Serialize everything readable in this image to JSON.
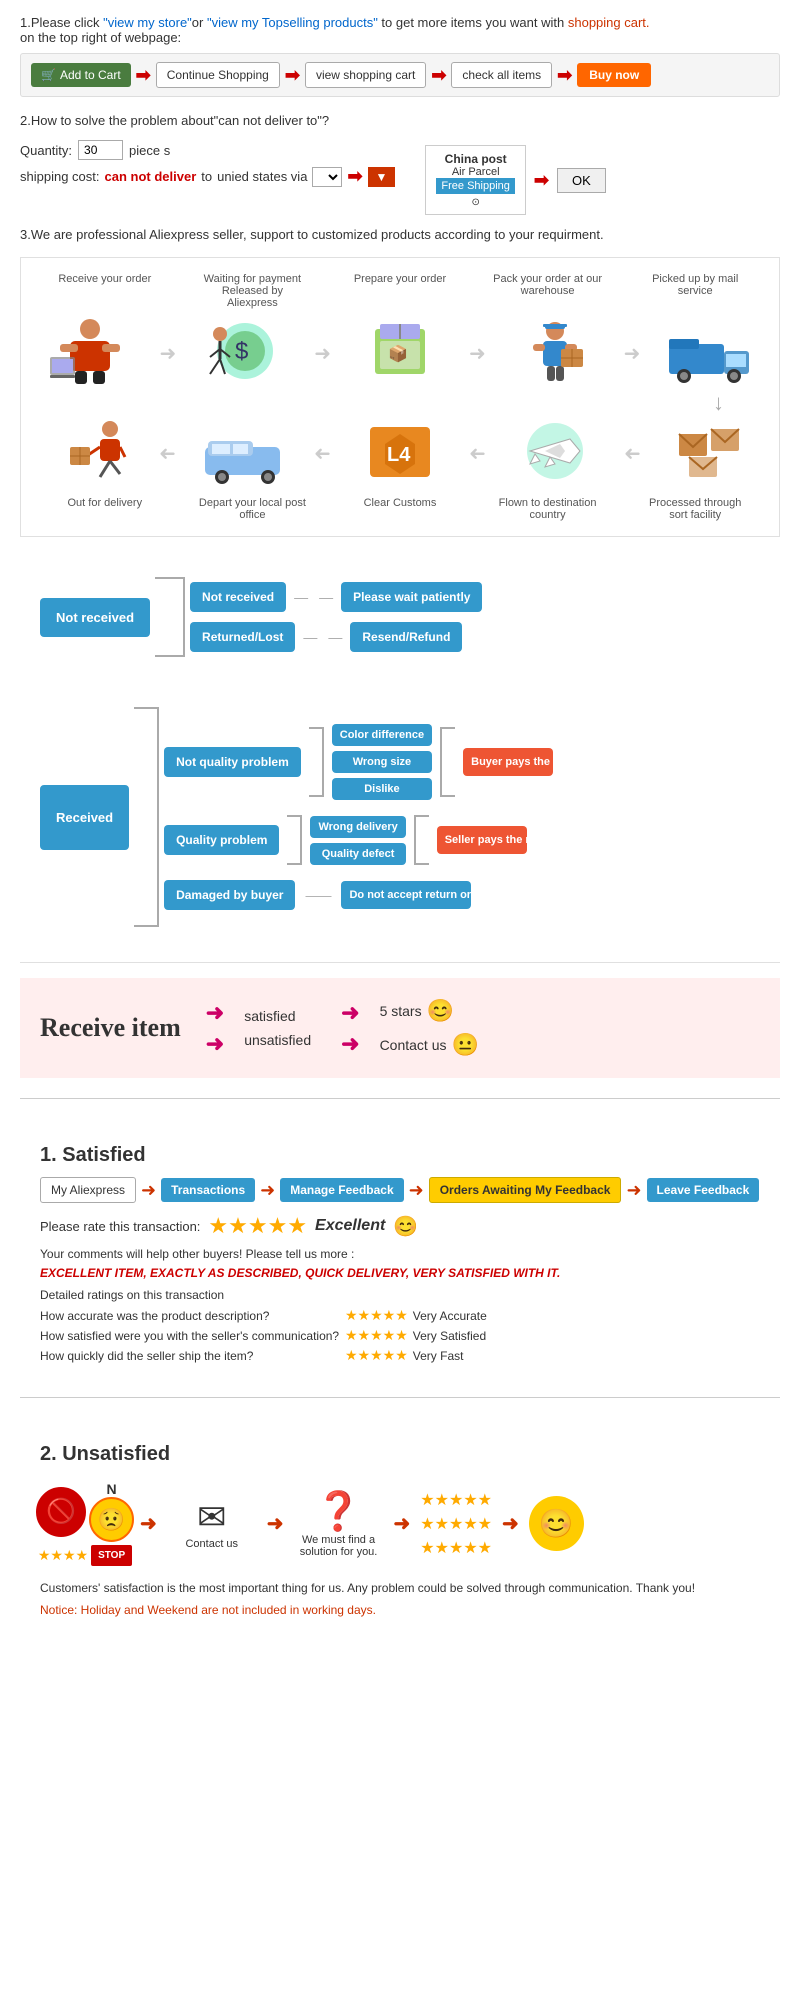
{
  "section1": {
    "text1": "1.Please click ",
    "link1": "\"view my store\"",
    "or": "or ",
    "link2": "\"view my Topselling products\"",
    "text2": " to get more items you want with",
    "shopping": "shopping cart.",
    "text3": "on the top right of webpage:",
    "cart_buttons": [
      "Add to Cart",
      "Continue Shopping",
      "view shopping cart",
      "check all items",
      "Buy now"
    ]
  },
  "section2": {
    "title": "2.How to solve the problem about\"can not deliver to\"?",
    "qty_label": "Quantity:",
    "qty_value": "30",
    "qty_suffix": "piece s",
    "shipping_label": "shipping cost:",
    "cannot_deliver": "can not deliver",
    "to": " to ",
    "via": "unied states via",
    "china_post_line1": "China post",
    "china_post_line2": "Air Parcel",
    "free_shipping": "Free Shipping",
    "ok": "OK"
  },
  "section3": {
    "text": "3.We are professional Aliexpress seller, support to customized products according to your requirment."
  },
  "flow": {
    "labels_top": [
      "Receive your order",
      "Waiting for payment Released by Aliexpress",
      "Prepare your order",
      "Pack your order at our warehouse",
      "Picked up by mail service"
    ],
    "labels_bottom": [
      "Out for delivery",
      "Depart your local post office",
      "Clear Customs",
      "Flown to destination country",
      "Processed through sort facility"
    ]
  },
  "not_received": {
    "main": "Not received",
    "branch1": "Not received",
    "branch2": "Returned/Lost",
    "outcome1": "Please wait patiently",
    "outcome2": "Resend/Refund"
  },
  "received": {
    "main": "Received",
    "branch1_label": "Not quality problem",
    "branch1_items": [
      "Color difference",
      "Wrong size",
      "Dislike"
    ],
    "branch1_outcome": "Buyer pays the return shipping fee",
    "branch2_label": "Quality problem",
    "branch2_items": [
      "Wrong delivery",
      "Quality defect"
    ],
    "branch2_outcome": "Seller pays the return shipping fee",
    "branch3_label": "Damaged by buyer",
    "branch3_outcome": "Do not accept return or exchange"
  },
  "pink_section": {
    "receive_item": "Receive item",
    "satisfied": "satisfied",
    "unsatisfied": "unsatisfied",
    "five_stars": "5 stars",
    "contact_us": "Contact us"
  },
  "satisfied": {
    "title": "1. Satisfied",
    "flow": [
      "My Aliexpress",
      "Transactions",
      "Manage Feedback",
      "Orders Awaiting My Feedback",
      "Leave Feedback"
    ],
    "rate_text": "Please rate this transaction:",
    "excellent": "Excellent",
    "comment_text": "Your comments will help other buyers! Please tell us more :",
    "excellent_item": "EXCELLENT ITEM, EXACTLY AS DESCRIBED, QUICK DELIVERY, VERY SATISFIED WITH IT.",
    "detailed": "Detailed ratings on this transaction",
    "rows": [
      {
        "label": "How accurate was the product description?",
        "stars": "★★★★★",
        "value": "Very Accurate"
      },
      {
        "label": "How satisfied were you with the seller's communication?",
        "stars": "★★★★★",
        "value": "Very Satisfied"
      },
      {
        "label": "How quickly did the seller ship the item?",
        "stars": "★★★★★",
        "value": "Very Fast"
      }
    ]
  },
  "unsatisfied": {
    "title": "2. Unsatisfied",
    "contact_us_label": "Contact us",
    "find_solution": "We must find a solution for you.",
    "notice": "Customers' satisfaction is the most important thing for us. Any problem could be solved through communication. Thank you!",
    "notice_red": "Notice: Holiday and Weekend are not included in working days."
  }
}
